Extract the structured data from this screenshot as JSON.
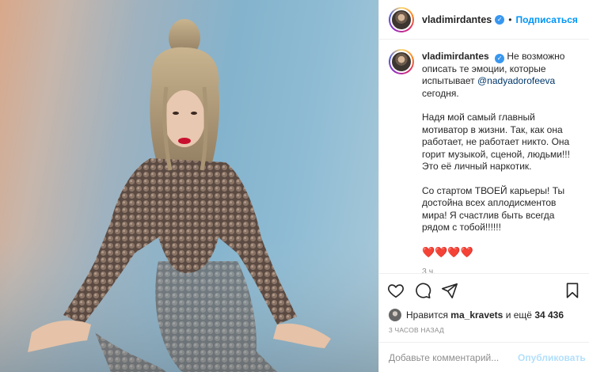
{
  "post": {
    "username": "vladimirdantes",
    "follow_label": "Подписаться",
    "dot": "•",
    "verified_glyph": "✓",
    "caption": {
      "mention": "@nadyadorofeeva",
      "part1_before_mention": "Не возможно описать те эмоции, которые испытывает",
      "part1_after_mention": "сегодня.",
      "paragraph2": "Надя мой самый главный мотиватор в жизни. Так, как она работает, не работает никто. Она горит музыкой, сценой, людьми!!! Это её личный наркотик.",
      "paragraph3": "Со стартом ТВОЕЙ карьеры! Ты достойна всех аплодисментов мира! Я счастлив быть всегда рядом с тобой!!!!!!",
      "hearts": "❤️❤️❤️❤️"
    },
    "caption_time": "3 ч.",
    "likes": {
      "prefix": "Нравится",
      "user": "ma_kravets",
      "suffix": "и ещё",
      "count": "34 436"
    },
    "date": "3 ЧАСОВ НАЗАД",
    "comment_placeholder": "Добавьте комментарий...",
    "publish_label": "Опубликовать"
  },
  "icons": {
    "like": "heart-icon",
    "comment": "comment-icon",
    "share": "share-icon",
    "save": "bookmark-icon"
  },
  "colors": {
    "link": "#0095f6",
    "verified": "#3897f0",
    "publish_disabled": "#b2dffc",
    "muted": "#8e8e8e",
    "text": "#262626"
  }
}
